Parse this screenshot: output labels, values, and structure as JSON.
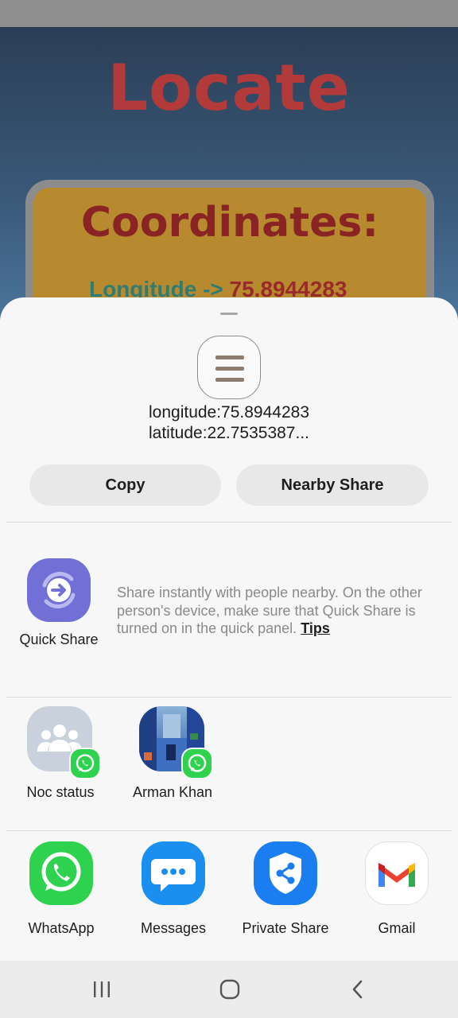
{
  "background_app": {
    "title": "Locate",
    "card_heading": "Coordinates:",
    "longitude_key": "Longitude -> ",
    "longitude_value": "75.8944283"
  },
  "share_sheet": {
    "preview_line1": "longitude:75.8944283",
    "preview_line2": "latitude:22.7535387...",
    "copy_label": "Copy",
    "nearby_label": "Nearby Share",
    "quick_share": {
      "label": "Quick Share",
      "description": "Share instantly with people nearby. On the other person's device, make sure that Quick Share is turned on in the quick panel.",
      "tips_label": "Tips"
    },
    "contacts": [
      {
        "name": "Noc status"
      },
      {
        "name": "Arman Khan"
      }
    ],
    "apps": [
      {
        "label": "WhatsApp"
      },
      {
        "label": "Messages"
      },
      {
        "label": "Private Share"
      },
      {
        "label": "Gmail"
      }
    ]
  },
  "nav": {
    "recent_icon": "recent-apps-icon",
    "home_icon": "home-icon",
    "back_icon": "back-icon"
  },
  "colors": {
    "accent_quick_share": "#7270d6",
    "whatsapp": "#2fd24e",
    "messages": "#1a8ff0",
    "private_share": "#1b7ef0"
  }
}
